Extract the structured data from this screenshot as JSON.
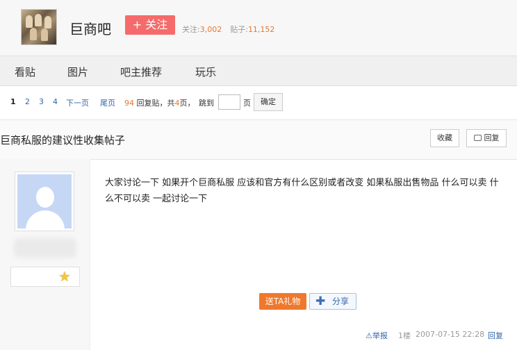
{
  "header": {
    "forum_name": "巨商吧",
    "follow_label": "+ 关注",
    "followers_label": "关注:",
    "followers_count": "3,002",
    "posts_label": "贴子:",
    "posts_count": "11,152"
  },
  "nav": {
    "items": [
      {
        "label": "看贴"
      },
      {
        "label": "图片"
      },
      {
        "label": "吧主推荐"
      },
      {
        "label": "玩乐"
      }
    ]
  },
  "pager": {
    "pages": [
      "1",
      "2",
      "3",
      "4"
    ],
    "next": "下一页",
    "last": "尾页",
    "reply_count": "94",
    "reply_label": "回复贴，共",
    "page_total": "4",
    "page_unit": "页，",
    "jump_label": "跳到",
    "page_suffix": "页",
    "confirm": "确定"
  },
  "thread": {
    "title": "巨商私服的建议性收集帖子",
    "collect_label": "收藏",
    "reply_label": "回复"
  },
  "post": {
    "content": "大家讨论一下 如果开个巨商私服 应该和官方有什么区别或者改变 如果私服出售物品 什么可以卖 什么不可以卖 一起讨论一下",
    "gift_label": "送TA礼物",
    "share_label": "分享",
    "report_label": "举报",
    "floor": "1楼",
    "timestamp": "2007-07-15 22:28",
    "reply_label": "回复"
  },
  "colors": {
    "follow": "#f56b6b",
    "accent_orange": "#e8772f",
    "link_blue": "#3366aa",
    "avatar_bg": "#c6d7f5"
  }
}
